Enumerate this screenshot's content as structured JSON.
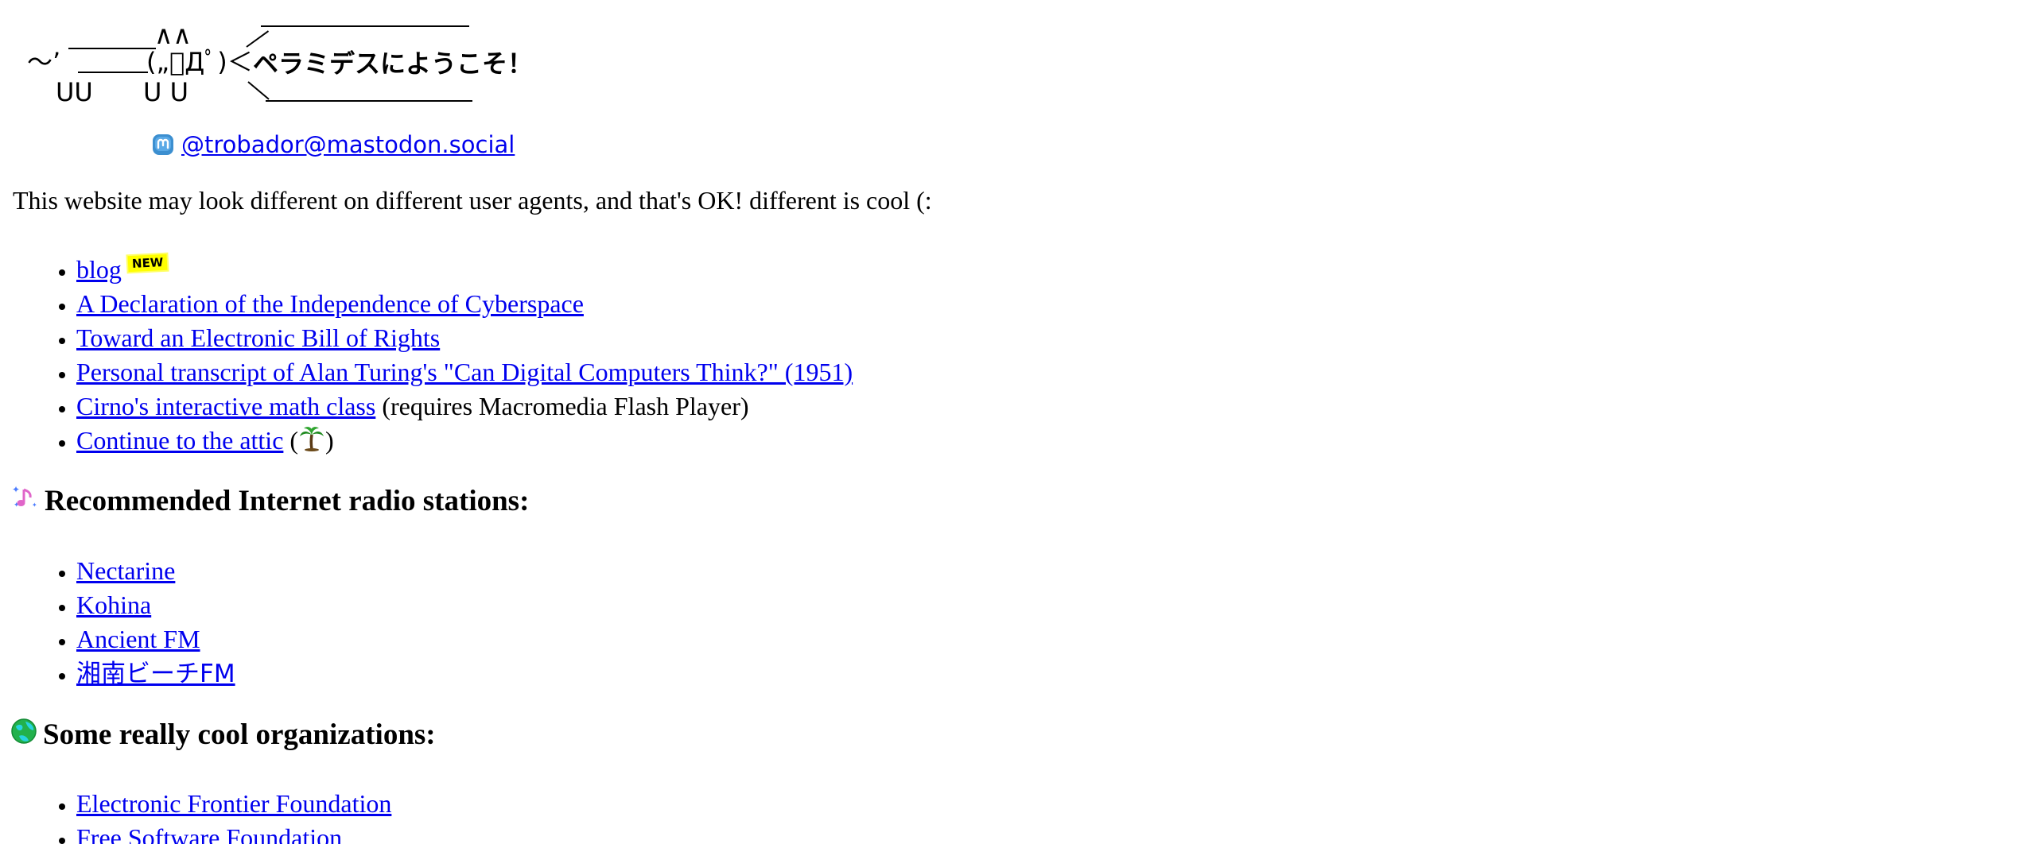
{
  "header": {
    "ascii_tail": "〜’",
    "ascii_paws_left": "UU",
    "ascii_paws_right": "U U",
    "ascii_face": "(„ﾟДﾟ)＜",
    "ascii_ears": "∧∧",
    "greeting": "ペラミデスにようこそ！",
    "mastodon_handle": "@trobador@mastodon.social",
    "mastodon_icon": "mastodon-icon"
  },
  "intro": "This website may look different on different user agents, and that's OK! different is cool (:",
  "main_links": [
    {
      "label": "blog",
      "badge": "NEW"
    },
    {
      "label": "A Declaration of the Independence of Cyberspace"
    },
    {
      "label": "Toward an Electronic Bill of Rights"
    },
    {
      "label": "Personal transcript of Alan Turing's \"Can Digital Computers Think?\" (1951)"
    },
    {
      "label": "Cirno's interactive math class",
      "note": " (requires Macromedia Flash Player)"
    },
    {
      "label": "Continue to the attic",
      "note_open": " (",
      "note_close": ")",
      "icon": "palm-tree-icon"
    }
  ],
  "radio": {
    "title": "Recommended Internet radio stations:",
    "icon": "music-note-icon",
    "stations": [
      "Nectarine",
      "Kohina",
      "Ancient FM",
      "湘南ビーチFM"
    ]
  },
  "orgs": {
    "title": "Some really cool organizations:",
    "icon": "globe-icon",
    "items": [
      "Electronic Frontier Foundation",
      "Free Software Foundation"
    ]
  },
  "colors": {
    "link": "#0000ee",
    "badge_bg": "#ffff00"
  }
}
